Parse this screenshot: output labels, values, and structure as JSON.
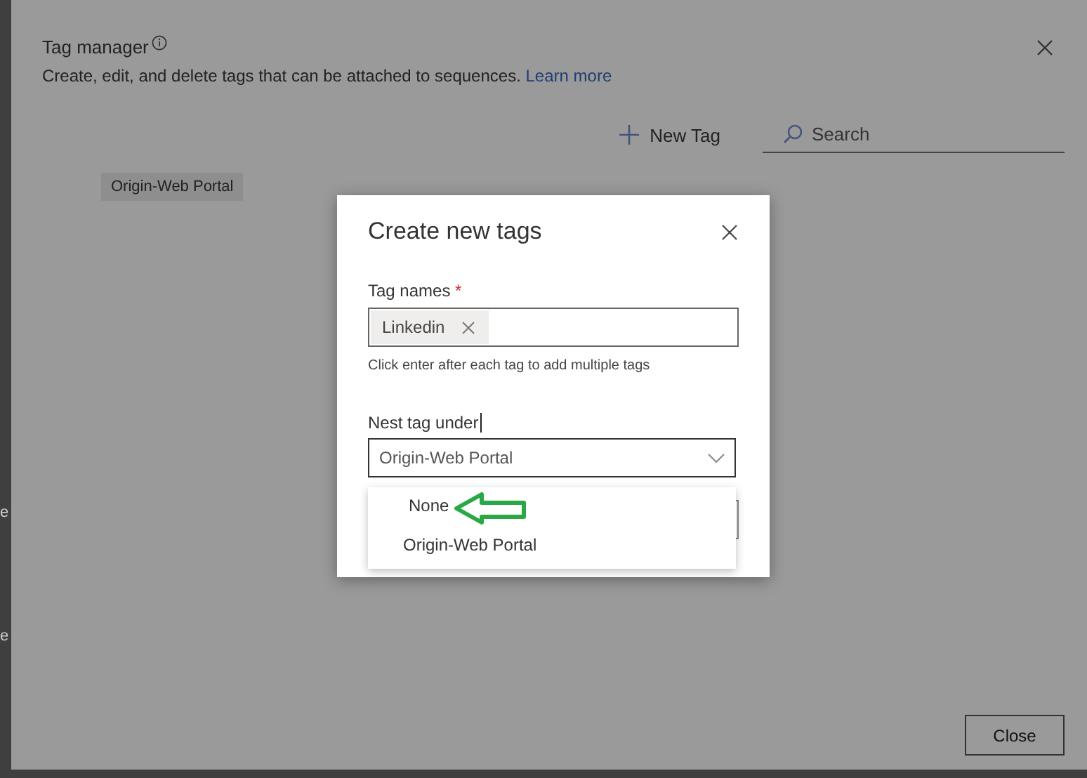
{
  "background_page": {
    "edge_texts": [
      "e",
      "e"
    ]
  },
  "panel": {
    "title": "Tag manager",
    "description": "Create, edit, and delete tags that can be attached to sequences.",
    "learn_more": "Learn more",
    "new_tag": "New Tag",
    "search": {
      "placeholder": "Search"
    },
    "tags": [
      "Origin-Web Portal"
    ],
    "close_button": "Close"
  },
  "dialog": {
    "title": "Create new tags",
    "tag_names": {
      "label": "Tag names",
      "required_mark": "*",
      "chips": [
        "Linkedin"
      ],
      "hint": "Click enter after each tag to add multiple tags"
    },
    "nest_under": {
      "label": "Nest tag under",
      "value": "Origin-Web Portal",
      "expanded": true,
      "options": [
        {
          "label": "None"
        },
        {
          "label": "Origin-Web Portal"
        }
      ]
    }
  }
}
